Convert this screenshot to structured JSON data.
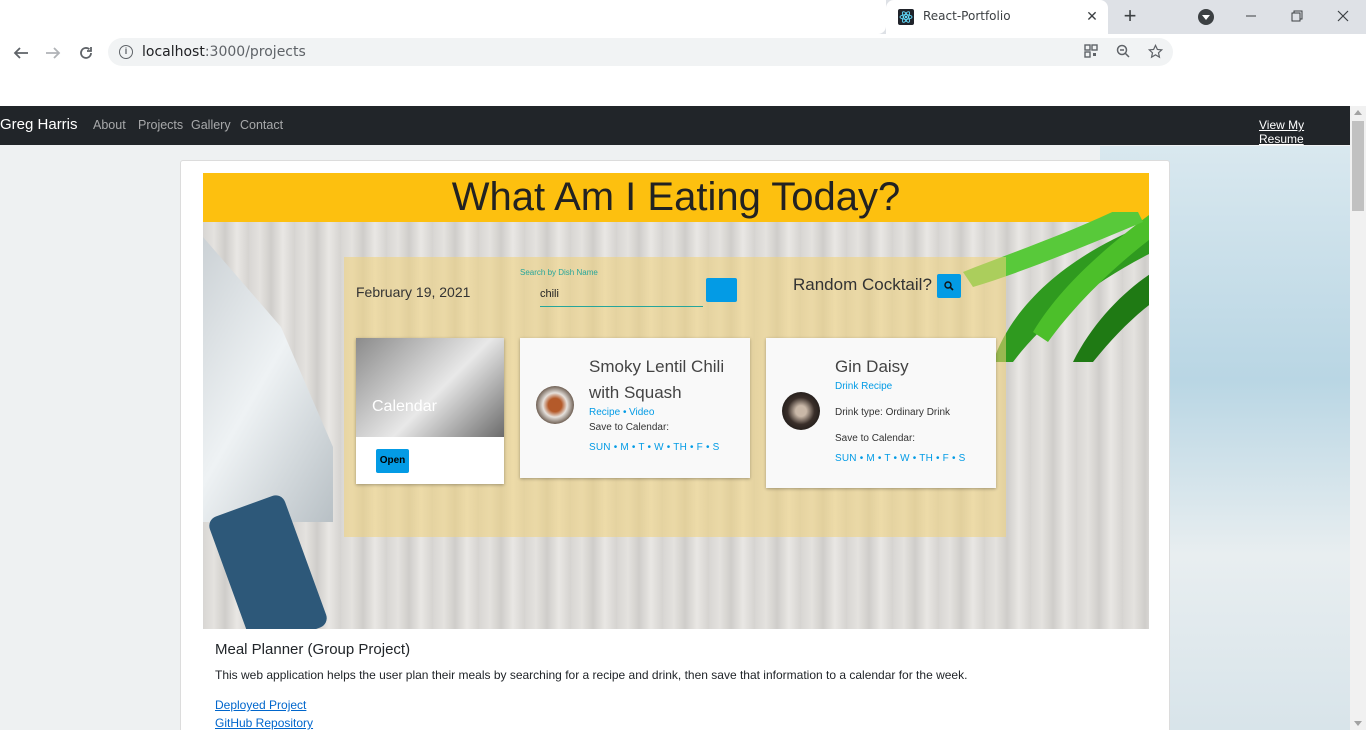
{
  "browser": {
    "tab_title": "React-Portfolio",
    "close_glyph": "✕",
    "new_tab_glyph": "+",
    "url_host": "localhost",
    "url_rest": ":3000/projects"
  },
  "navbar": {
    "brand": "Greg Harris",
    "links": [
      "About",
      "Projects",
      "Gallery",
      "Contact"
    ],
    "resume": "View My Resume"
  },
  "app": {
    "banner_title": "What Am I Eating Today?",
    "date": "February 19, 2021",
    "search_label": "Search by Dish Name",
    "search_value": "chili",
    "cocktail_prompt": "Random Cocktail?",
    "calendar": {
      "title": "Calendar",
      "open_label": "Open"
    },
    "dish": {
      "title": "Smoky Lentil Chili with Squash",
      "recipe": "Recipe",
      "video": "Video",
      "save_label": "Save to Calendar:",
      "days": "SUN • M • T • W • TH • F • S"
    },
    "drink": {
      "title": "Gin Daisy",
      "recipe": "Drink Recipe",
      "type": "Drink type: Ordinary Drink",
      "save_label": "Save to Calendar:",
      "days": "SUN • M • T • W • TH • F • S"
    }
  },
  "project": {
    "title": "Meal Planner (Group Project)",
    "description": "This web application helps the user plan their meals by searching for a recipe and drink, then save that information to a calendar for the week.",
    "deployed_link": "Deployed Project",
    "repo_link": "GitHub Repository"
  },
  "colors": {
    "navbar_bg": "#212529",
    "banner_bg": "#fdc00f",
    "accent_blue": "#039be5",
    "teal": "#26a69a"
  },
  "icons": [
    "react-icon",
    "back-icon",
    "forward-icon",
    "reload-icon",
    "info-icon",
    "qr-icon",
    "zoom-icon",
    "star-icon",
    "search-icon"
  ]
}
